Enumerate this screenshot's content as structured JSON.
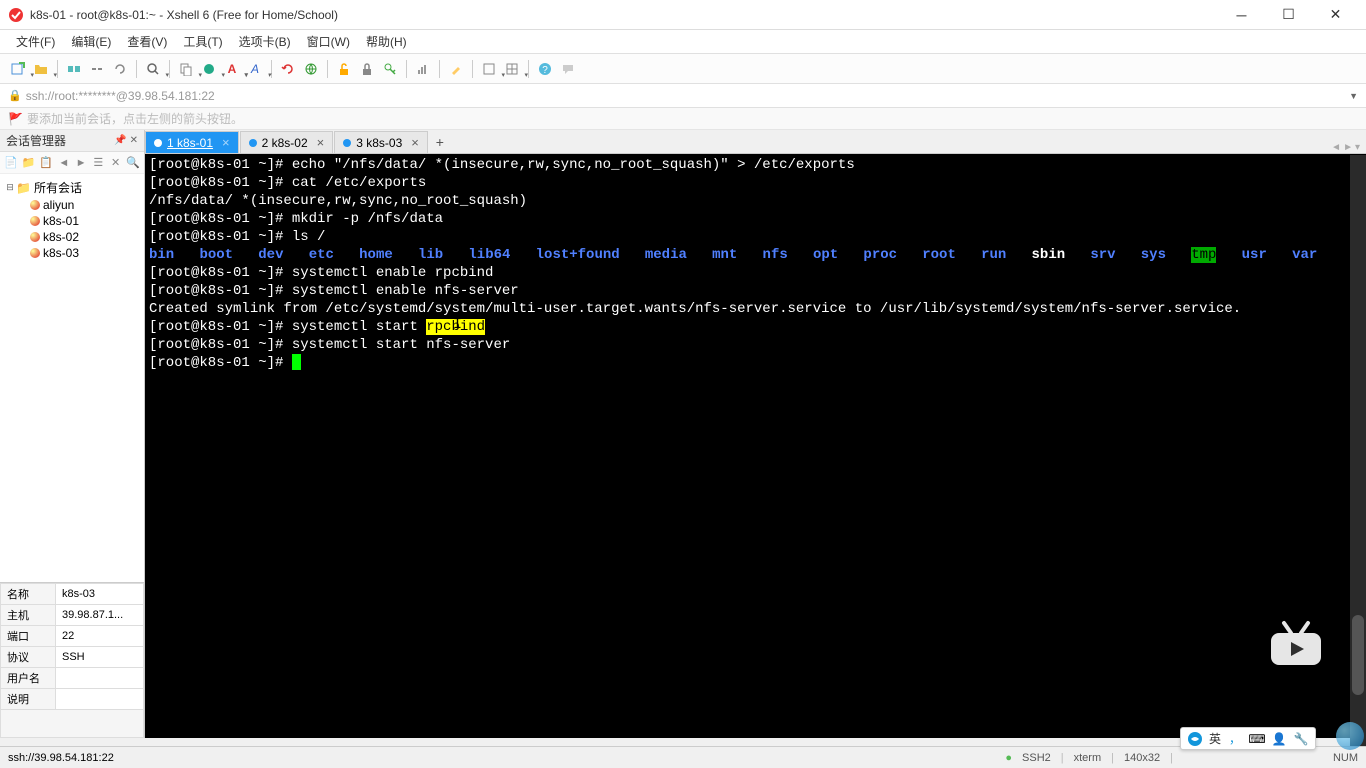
{
  "window": {
    "title": "k8s-01 - root@k8s-01:~ - Xshell 6 (Free for Home/School)"
  },
  "menu": {
    "file": "文件(F)",
    "edit": "编辑(E)",
    "view": "查看(V)",
    "tools": "工具(T)",
    "tabs": "选项卡(B)",
    "window": "窗口(W)",
    "help": "帮助(H)"
  },
  "addressbar": {
    "text": "ssh://root:********@39.98.54.181:22"
  },
  "hint": {
    "text": "要添加当前会话，点击左侧的箭头按钮。"
  },
  "sidebar": {
    "title": "会话管理器",
    "root": "所有会话",
    "items": [
      "aliyun",
      "k8s-01",
      "k8s-02",
      "k8s-03"
    ]
  },
  "props": {
    "name_label": "名称",
    "name_value": "k8s-03",
    "host_label": "主机",
    "host_value": "39.98.87.1...",
    "port_label": "端口",
    "port_value": "22",
    "proto_label": "协议",
    "proto_value": "SSH",
    "user_label": "用户名",
    "user_value": "",
    "desc_label": "说明",
    "desc_value": ""
  },
  "tabs": {
    "t1": "1 k8s-01",
    "t2": "2 k8s-02",
    "t3": "3 k8s-03"
  },
  "terminal": {
    "l1_prompt": "[root@k8s-01 ~]# ",
    "l1_cmd": "echo \"/nfs/data/ *(insecure,rw,sync,no_root_squash)\" > /etc/exports",
    "l2_prompt": "[root@k8s-01 ~]# ",
    "l2_cmd": "cat /etc/exports",
    "l3": "/nfs/data/ *(insecure,rw,sync,no_root_squash)",
    "l4_prompt": "[root@k8s-01 ~]# ",
    "l4_cmd": "mkdir -p /nfs/data",
    "l5_prompt": "[root@k8s-01 ~]# ",
    "l5_cmd": "ls /",
    "dirs": {
      "bin": "bin",
      "boot": "boot",
      "dev": "dev",
      "etc": "etc",
      "home": "home",
      "lib": "lib",
      "lib64": "lib64",
      "lost": "lost+found",
      "media": "media",
      "mnt": "mnt",
      "nfs": "nfs",
      "opt": "opt",
      "proc": "proc",
      "root": "root",
      "run": "run",
      "sbin": "sbin",
      "srv": "srv",
      "sys": "sys",
      "tmp": "tmp",
      "usr": "usr",
      "var": "var"
    },
    "l7_prompt": "[root@k8s-01 ~]# ",
    "l7_cmd": "systemctl enable rpcbind",
    "l8_prompt": "[root@k8s-01 ~]# ",
    "l8_cmd": "systemctl enable nfs-server",
    "l9": "Created symlink from /etc/systemd/system/multi-user.target.wants/nfs-server.service to /usr/lib/systemd/system/nfs-server.service.",
    "l10_prompt": "[root@k8s-01 ~]# ",
    "l10_cmd_a": "systemctl start ",
    "l10_sel": "rpcbind",
    "l11_prompt": "[root@k8s-01 ~]# ",
    "l11_cmd": "systemctl start nfs-server",
    "l12_prompt": "[root@k8s-01 ~]# "
  },
  "statusbar": {
    "left": "ssh://39.98.54.181:22",
    "ssh": "SSH2",
    "term": "xterm",
    "size": "140x32",
    "num": "NUM"
  },
  "taskbar": {
    "text": "英"
  }
}
